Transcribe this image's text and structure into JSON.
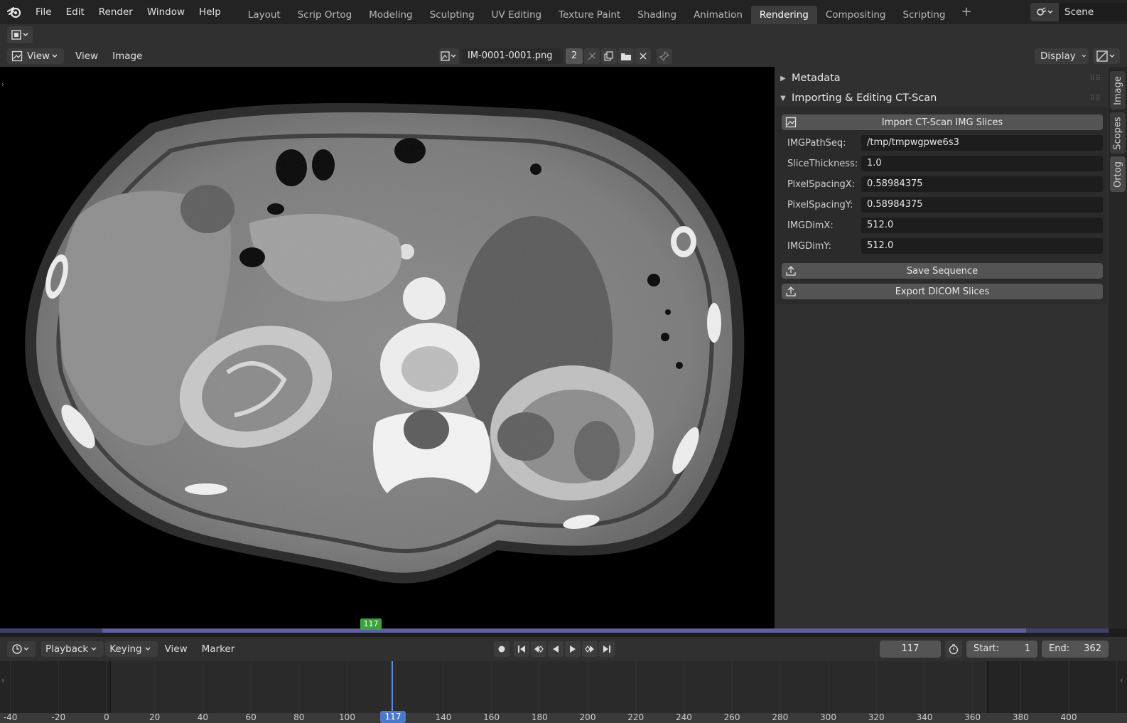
{
  "topbar": {
    "menu": [
      "File",
      "Edit",
      "Render",
      "Window",
      "Help"
    ],
    "workspaces": [
      "Layout",
      "Scrip Ortog",
      "Modeling",
      "Sculpting",
      "UV Editing",
      "Texture Paint",
      "Shading",
      "Animation",
      "Rendering",
      "Compositing",
      "Scripting"
    ],
    "active_workspace": "Rendering",
    "add_label": "+",
    "scene_name": "Scene"
  },
  "image_editor": {
    "view_mode": "View",
    "menu_view": "View",
    "menu_image": "Image",
    "image_name": "IM-0001-0001.png",
    "user_count": "2",
    "display_label": "Display"
  },
  "sidebar": {
    "tabs": [
      "Image",
      "Scopes",
      "Ortog"
    ],
    "active_tab": "Ortog",
    "metadata_label": "Metadata",
    "panel_title": "Importing & Editing CT-Scan",
    "import_button": "Import CT-Scan IMG Slices",
    "properties": [
      {
        "label": "IMGPathSeq:",
        "value": "/tmp/tmpwgpwe6s3"
      },
      {
        "label": "SliceThickness:",
        "value": "1.0"
      },
      {
        "label": "PixelSpacingX:",
        "value": "0.58984375"
      },
      {
        "label": "PixelSpacingY:",
        "value": "0.58984375"
      },
      {
        "label": "IMGDimX:",
        "value": "512.0"
      },
      {
        "label": "IMGDimY:",
        "value": "512.0"
      }
    ],
    "save_button": "Save Sequence",
    "export_button": "Export DICOM Slices"
  },
  "timeline": {
    "playback_label": "Playback",
    "keying_label": "Keying",
    "view_label": "View",
    "marker_label": "Marker",
    "current_frame": "117",
    "start_label": "Start:",
    "start_value": "1",
    "end_label": "End:",
    "end_value": "362",
    "ruler_ticks": [
      "-40",
      "-20",
      "0",
      "20",
      "40",
      "60",
      "80",
      "100",
      "140",
      "160",
      "180",
      "200",
      "220",
      "240",
      "260",
      "280",
      "300",
      "320",
      "340",
      "360",
      "380",
      "400"
    ]
  },
  "colors": {
    "accent_blue": "#4a7ac8",
    "frame_green": "#3fa040",
    "scrub_purple": "#5f5fa0"
  }
}
